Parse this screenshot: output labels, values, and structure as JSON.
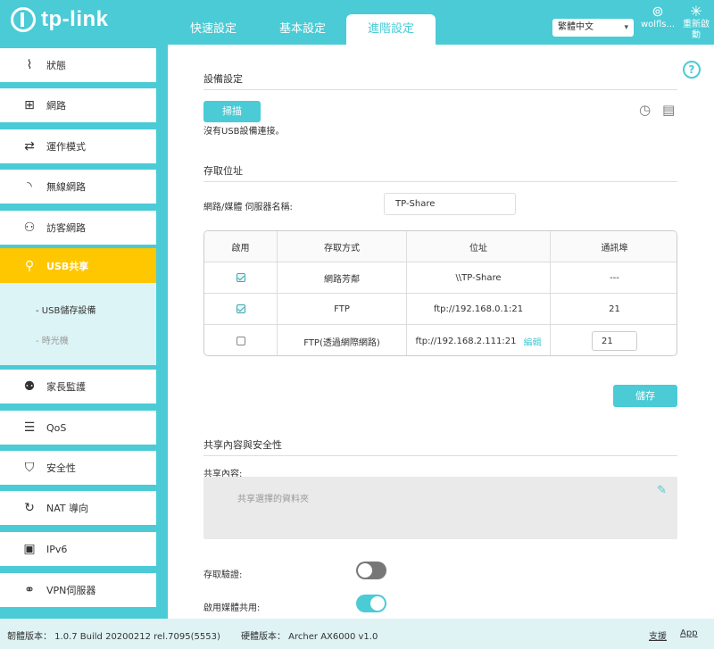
{
  "header": {
    "brand": "tp-link",
    "tabs": [
      {
        "label": "快速設定",
        "active": false
      },
      {
        "label": "基本設定",
        "active": false
      },
      {
        "label": "進階設定",
        "active": true
      }
    ],
    "language": "繁體中文",
    "user_label": "wolfls...",
    "reboot_label": "重新啟",
    "reboot_label2": "動"
  },
  "sidebar": {
    "items": [
      {
        "label": "狀態",
        "icon": "pulse-icon"
      },
      {
        "label": "網路",
        "icon": "network-icon"
      },
      {
        "label": "運作模式",
        "icon": "mode-icon"
      },
      {
        "label": "無線網路",
        "icon": "wifi-icon"
      },
      {
        "label": "訪客網路",
        "icon": "guest-icon"
      },
      {
        "label": "USB共享",
        "icon": "usb-icon",
        "active": true
      },
      {
        "label": "家長監護",
        "icon": "parental-icon"
      },
      {
        "label": "QoS",
        "icon": "qos-icon"
      },
      {
        "label": "安全性",
        "icon": "shield-icon"
      },
      {
        "label": "NAT 導向",
        "icon": "nat-icon"
      },
      {
        "label": "IPv6",
        "icon": "ipv6-icon"
      },
      {
        "label": "VPN伺服器",
        "icon": "vpn-icon"
      }
    ],
    "subitems": [
      {
        "label": "- USB儲存設備",
        "active": true
      },
      {
        "label": "- 時光機",
        "active": false
      }
    ]
  },
  "device_settings": {
    "title": "設備設定",
    "scan_button": "掃描",
    "no_device_text": "沒有USB設備連接。"
  },
  "access_address": {
    "title": "存取位址",
    "server_name_label": "網路/媒體 伺服器名稱:",
    "server_name_value": "TP-Share",
    "table": {
      "headers": [
        "啟用",
        "存取方式",
        "位址",
        "通訊埠"
      ],
      "rows": [
        {
          "enabled": true,
          "method": "網路芳鄰",
          "address": "\\\\TP-Share",
          "port": "---"
        },
        {
          "enabled": true,
          "method": "FTP",
          "address": "ftp://192.168.0.1:21",
          "port": "21"
        },
        {
          "enabled": false,
          "method": "FTP(透過網際網路)",
          "address": "ftp://192.168.2.111:21",
          "edit_label": "編輯",
          "port": "21"
        }
      ]
    },
    "save_button": "儲存"
  },
  "sharing": {
    "title": "共享內容與安全性",
    "content_label": "共享內容:",
    "content_placeholder": "共享選擇的資料夾",
    "auth_label": "存取驗證:",
    "auth_enabled": false,
    "media_label": "啟用媒體共用:",
    "media_enabled": true
  },
  "footer": {
    "firmware": "韌體版本： 1.0.7 Build 20200212 rel.7095(5553)",
    "hardware": "硬體版本： Archer AX6000 v1.0",
    "support": "支援",
    "app": "App"
  },
  "colors": {
    "accent": "#4acbd6",
    "active_menu": "#ffc700"
  }
}
